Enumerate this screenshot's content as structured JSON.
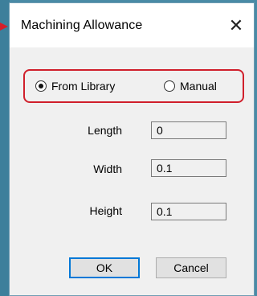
{
  "dialog": {
    "title": "Machining Allowance",
    "close_symbol": "✕"
  },
  "source": {
    "options": [
      {
        "label": "From Library",
        "checked": true
      },
      {
        "label": "Manual",
        "checked": false
      }
    ],
    "highlight_color": "#d01f2b"
  },
  "fields": {
    "length": {
      "label": "Length",
      "value": "0"
    },
    "width": {
      "label": "Width",
      "value": "0.1"
    },
    "height": {
      "label": "Height",
      "value": "0.1"
    }
  },
  "buttons": {
    "ok_label": "OK",
    "cancel_label": "Cancel"
  },
  "colors": {
    "accent": "#0078d7",
    "background": "#4a8ba6"
  }
}
